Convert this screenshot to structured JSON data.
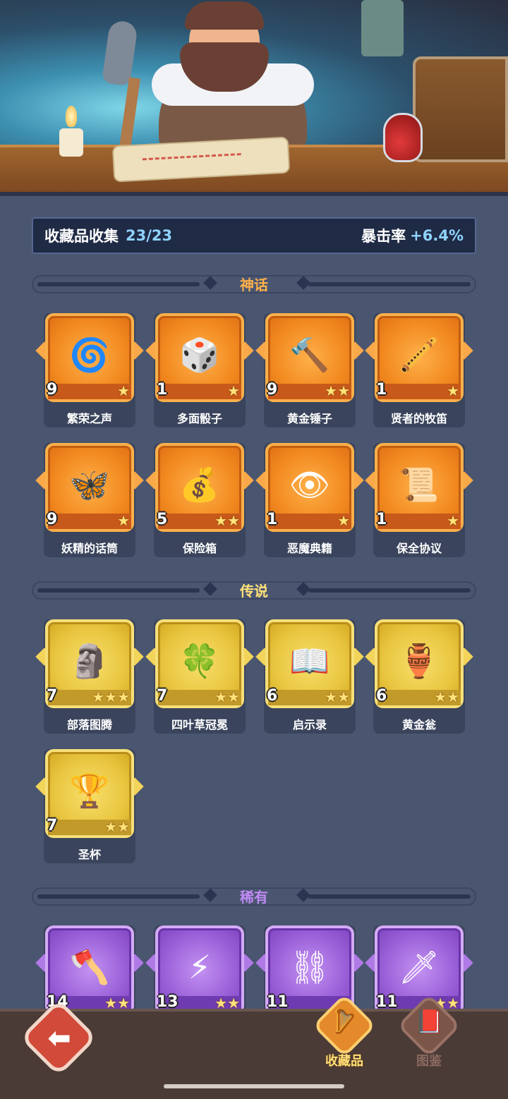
{
  "colors": {
    "mythic": "#f28a20",
    "legend": "#e9c640",
    "rare": "#9a60d8",
    "mythic_title": "#ffb04a",
    "legend_title": "#ffe07a",
    "rare_title": "#c08af5",
    "accent_value": "#8fd3ff"
  },
  "collection": {
    "title": "收藏品收集",
    "count": "23/23",
    "crit_label": "暴击率",
    "crit_value": "+6.4%"
  },
  "sections": {
    "mythic": {
      "title": "神话",
      "items": [
        {
          "name": "繁荣之声",
          "count": "9",
          "stars": "★",
          "icon": "🌀",
          "icon_name": "spirit-orb-icon"
        },
        {
          "name": "多面骰子",
          "count": "1",
          "stars": "★",
          "icon": "🎲",
          "icon_name": "dice-icon"
        },
        {
          "name": "黄金锤子",
          "count": "9",
          "stars": "★★",
          "icon": "🔨",
          "icon_name": "hammer-icon"
        },
        {
          "name": "贤者的牧笛",
          "count": "1",
          "stars": "★",
          "icon": "🪈",
          "icon_name": "flute-icon"
        },
        {
          "name": "妖精的话筒",
          "count": "9",
          "stars": "★",
          "icon": "🦋",
          "icon_name": "fairy-microphone-icon"
        },
        {
          "name": "保险箱",
          "count": "5",
          "stars": "★★",
          "icon": "💰",
          "icon_name": "treasure-chest-icon"
        },
        {
          "name": "恶魔典籍",
          "count": "1",
          "stars": "★",
          "icon": "👁",
          "icon_name": "demon-book-icon"
        },
        {
          "name": "保全协议",
          "count": "1",
          "stars": "★",
          "icon": "📜",
          "icon_name": "contract-scroll-icon"
        }
      ]
    },
    "legend": {
      "title": "传说",
      "items": [
        {
          "name": "部落图腾",
          "count": "7",
          "stars": "★★★",
          "icon": "🗿",
          "icon_name": "totem-icon"
        },
        {
          "name": "四叶草冠冕",
          "count": "7",
          "stars": "★★",
          "icon": "🍀",
          "icon_name": "clover-crown-icon"
        },
        {
          "name": "启示录",
          "count": "6",
          "stars": "★★",
          "icon": "📖",
          "icon_name": "open-book-icon"
        },
        {
          "name": "黄金瓮",
          "count": "6",
          "stars": "★★",
          "icon": "🏺",
          "icon_name": "golden-urn-icon"
        },
        {
          "name": "圣杯",
          "count": "7",
          "stars": "★★",
          "icon": "🏆",
          "icon_name": "grail-icon"
        }
      ]
    },
    "rare": {
      "title": "稀有",
      "items": [
        {
          "name": "",
          "count": "14",
          "stars": "★★",
          "icon": "🪓",
          "icon_name": "axe-icon"
        },
        {
          "name": "",
          "count": "13",
          "stars": "★★",
          "icon": "⚡",
          "icon_name": "lightning-card-icon"
        },
        {
          "name": "",
          "count": "11",
          "stars": "★",
          "icon": "⛓",
          "icon_name": "chain-icon"
        },
        {
          "name": "",
          "count": "11",
          "stars": "★★",
          "icon": "🗡",
          "icon_name": "ice-sword-icon"
        }
      ]
    }
  },
  "nav": {
    "back_icon": "⬅",
    "tab_collection": {
      "label": "收藏品",
      "icon": "🪉"
    },
    "tab_codex": {
      "label": "图鉴",
      "icon": "📕"
    }
  }
}
